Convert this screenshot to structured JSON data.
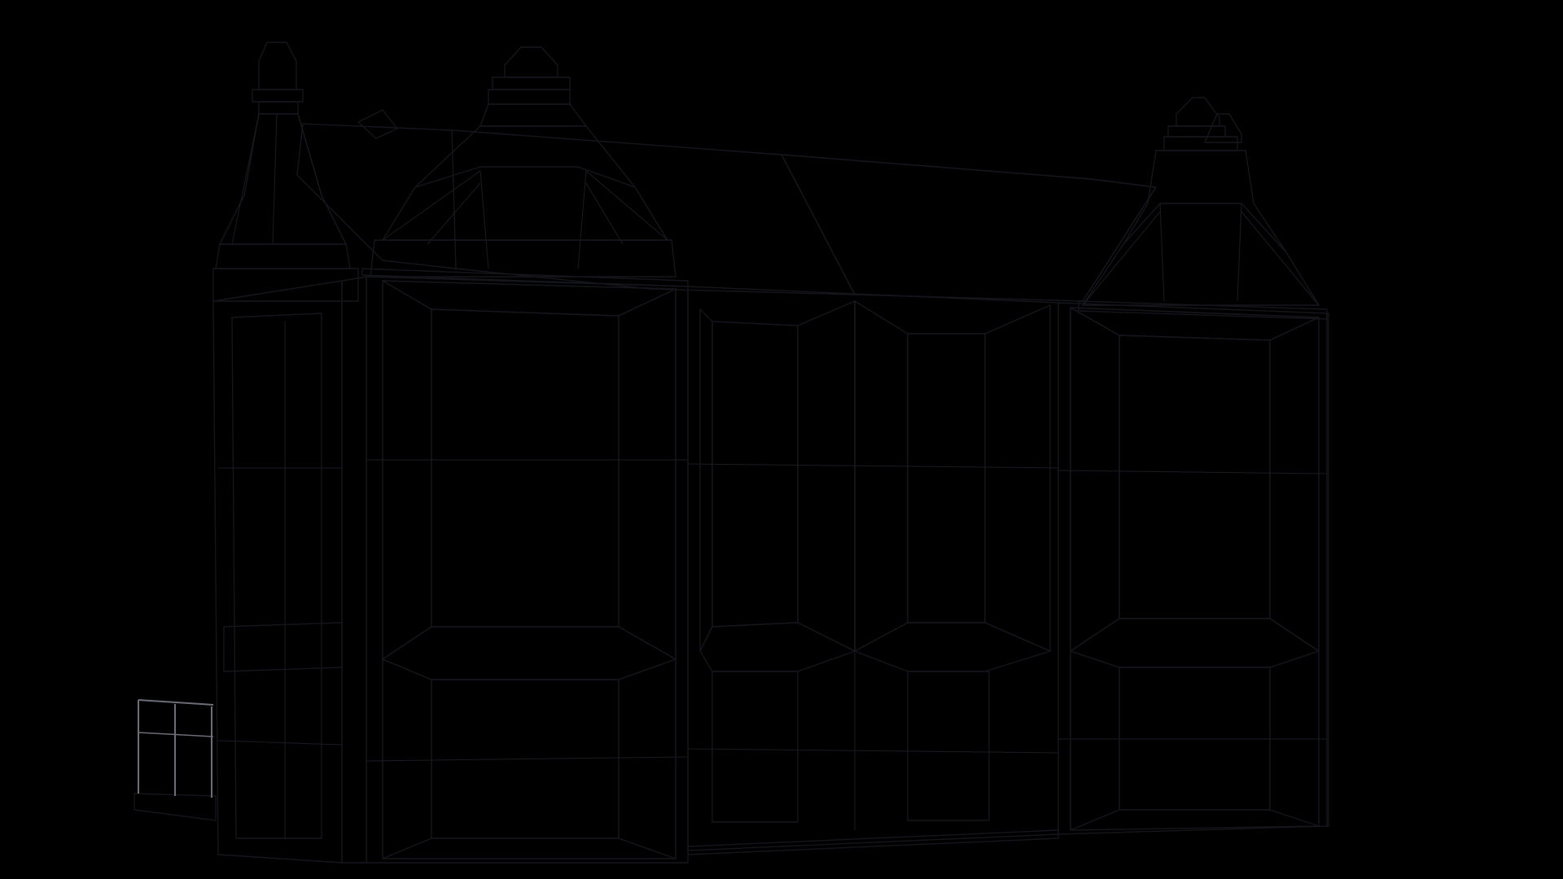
{
  "scene": {
    "background_color": "#000000",
    "model": "gray-wireframe-house",
    "shading": "flat-gray-with-wireframe",
    "colors": {
      "wall_light": "#5a5c69",
      "wall_mid": "#50525e",
      "wall_dark": "#454651",
      "wall_shadow": "#3a3b45",
      "roof": "#5d5e6b",
      "roof_dark": "#4d4e5a",
      "edge": "#15161c"
    }
  }
}
